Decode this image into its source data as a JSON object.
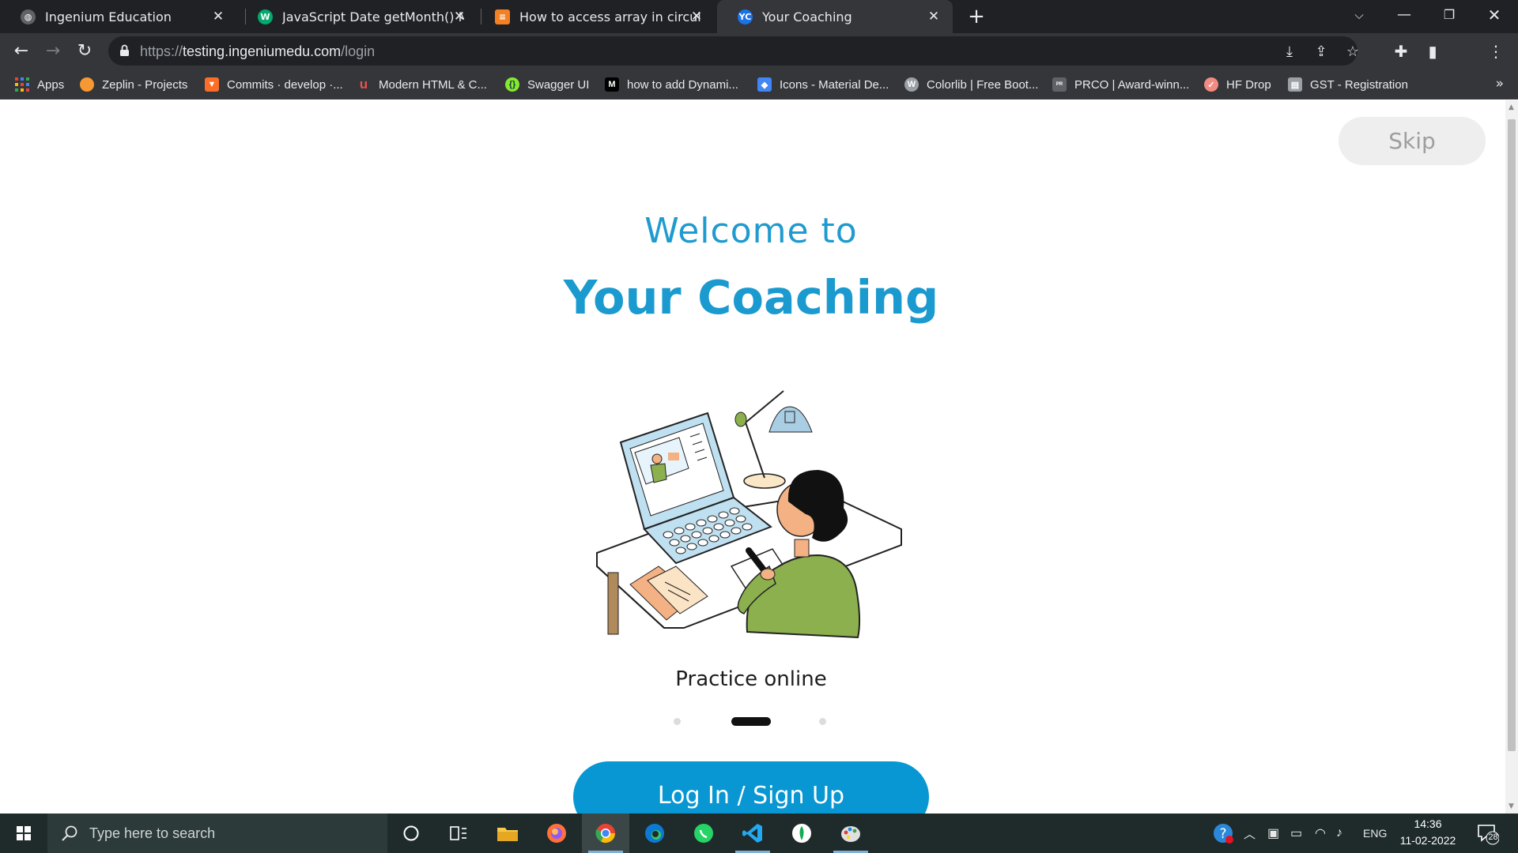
{
  "browser": {
    "tabs": [
      {
        "title": "Ingenium Education",
        "icon": "globe-icon",
        "color": "#9aa0a6"
      },
      {
        "title": "JavaScript Date getMonth() Meth",
        "icon": "w3schools-icon",
        "color": "#04aa6d"
      },
      {
        "title": "How to access array in circular m",
        "icon": "stackoverflow-icon",
        "color": "#f48024"
      },
      {
        "title": "Your Coaching",
        "icon": "yourcoaching-icon",
        "color": "#1a73e8"
      }
    ],
    "address": {
      "scheme": "https://",
      "host": "testing.ingeniumedu.com",
      "path": "/login"
    },
    "bookmarks": [
      {
        "label": "Apps",
        "icon": "apps-grid-icon",
        "color": "#e94235"
      },
      {
        "label": "Zeplin - Projects",
        "icon": "zeplin-icon",
        "color": "#f69833"
      },
      {
        "label": "Commits · develop ·...",
        "icon": "gitlab-icon",
        "color": "#fc6d26"
      },
      {
        "label": "Modern HTML & C...",
        "icon": "udemy-icon",
        "color": "#a435f0"
      },
      {
        "label": "Swagger UI",
        "icon": "swagger-icon",
        "color": "#85ea2d"
      },
      {
        "label": "how to add Dynami...",
        "icon": "medium-icon",
        "color": "#000000"
      },
      {
        "label": "Icons - Material De...",
        "icon": "material-icon",
        "color": "#4285f4"
      },
      {
        "label": "Colorlib | Free Boot...",
        "icon": "wordpress-icon",
        "color": "#9aa0a6"
      },
      {
        "label": "PRCO | Award-winn...",
        "icon": "prco-icon",
        "color": "#5f6368"
      },
      {
        "label": "HF Drop",
        "icon": "hfdrop-icon",
        "color": "#f28b82"
      },
      {
        "label": "GST - Registration",
        "icon": "gst-icon",
        "color": "#9aa0a6"
      }
    ],
    "bookmarks_more": "»"
  },
  "page": {
    "skip_label": "Skip",
    "welcome": "Welcome to",
    "brand": "Your Coaching",
    "caption": "Practice online",
    "carousel": {
      "count": 3,
      "active": 1
    },
    "cta_label": "Log In / Sign Up",
    "accent": "#0897d2"
  },
  "taskbar": {
    "search_placeholder": "Type here to search",
    "language": "ENG",
    "time": "14:36",
    "date": "11-02-2022",
    "notifications": "28"
  }
}
